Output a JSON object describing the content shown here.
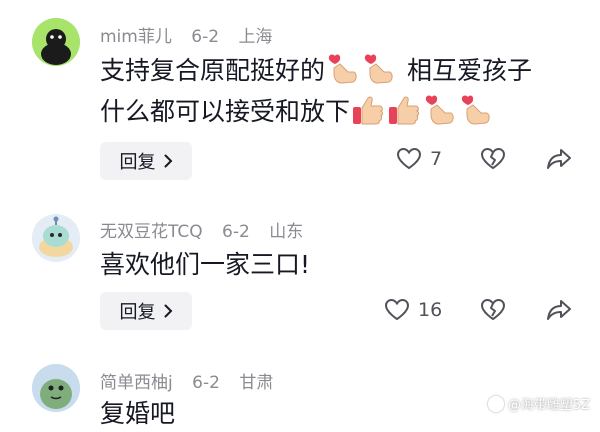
{
  "comments": [
    {
      "author": "mim菲儿",
      "date": "6-2",
      "location": "上海",
      "line1_part1": "支持复合原配挺好的",
      "line1_part2": "相互爱孩子",
      "line2": "什么都可以接受和放下",
      "reply_label": "回复",
      "like_count": "7",
      "avatar_color": "#a8e36a"
    },
    {
      "author": "无双豆花TCQ",
      "date": "6-2",
      "location": "山东",
      "line1": "喜欢他们一家三口!",
      "reply_label": "回复",
      "like_count": "16",
      "avatar_color": "#dbe7f3"
    },
    {
      "author": "简单西柚j",
      "date": "6-2",
      "location": "甘肃",
      "line1": "复婚吧",
      "avatar_color": "#b9d4e6"
    }
  ],
  "watermark": "@海带雕塑5Z",
  "icons": [
    "heart-outline-icon",
    "broken-heart-icon",
    "share-arrow-icon",
    "heart-hands-emoji",
    "thumbs-up-emoji",
    "chevron-right-icon"
  ]
}
